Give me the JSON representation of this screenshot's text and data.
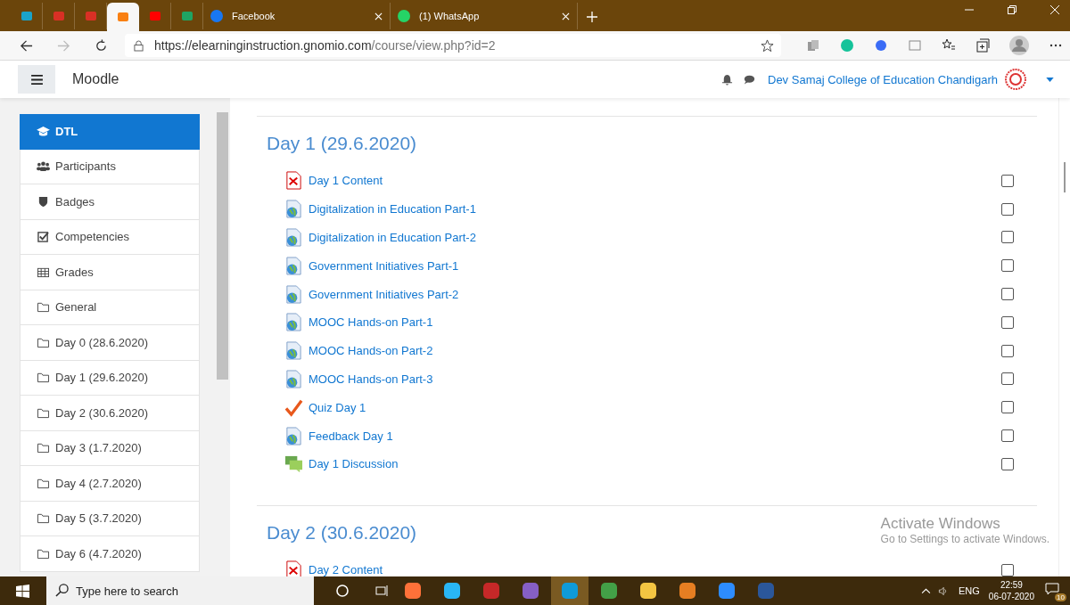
{
  "browser_tabs": [
    {
      "kind": "app",
      "selected": false
    },
    {
      "kind": "mail",
      "selected": false
    },
    {
      "kind": "mail",
      "selected": false
    },
    {
      "kind": "moodle",
      "selected": true
    },
    {
      "kind": "video",
      "selected": false
    },
    {
      "kind": "drive",
      "selected": false
    },
    {
      "kind": "facebook",
      "title": "Facebook",
      "selected": false
    },
    {
      "kind": "whatsapp",
      "title": "(1) WhatsApp",
      "selected": false
    }
  ],
  "address_bar": {
    "host": "https://elearninginstruction.gnomio.com",
    "path": "/course/view.php?id=2"
  },
  "header": {
    "site_name": "Moodle",
    "user_name": "Dev Samaj College of Education Chandigarh"
  },
  "sidebar": {
    "items": [
      {
        "kind": "course",
        "label": "DTL",
        "selected": true
      },
      {
        "kind": "users",
        "label": "Participants",
        "selected": false
      },
      {
        "kind": "shield",
        "label": "Badges",
        "selected": false
      },
      {
        "kind": "check",
        "label": "Competencies",
        "selected": false
      },
      {
        "kind": "table",
        "label": "Grades",
        "selected": false
      },
      {
        "kind": "folder",
        "label": "General",
        "selected": false
      },
      {
        "kind": "folder",
        "label": "Day 0 (28.6.2020)",
        "selected": false
      },
      {
        "kind": "folder",
        "label": "Day 1 (29.6.2020)",
        "selected": false
      },
      {
        "kind": "folder",
        "label": "Day 2 (30.6.2020)",
        "selected": false
      },
      {
        "kind": "folder",
        "label": "Day 3 (1.7.2020)",
        "selected": false
      },
      {
        "kind": "folder",
        "label": "Day 4 (2.7.2020)",
        "selected": false
      },
      {
        "kind": "folder",
        "label": "Day 5 (3.7.2020)",
        "selected": false
      },
      {
        "kind": "folder",
        "label": "Day 6 (4.7.2020)",
        "selected": false
      }
    ]
  },
  "sections": [
    {
      "title": "Day 1 (29.6.2020)",
      "activities": [
        {
          "kind": "pdf",
          "name": "Day 1 Content",
          "checked": false
        },
        {
          "kind": "url",
          "name": "Digitalization in Education Part-1",
          "checked": false
        },
        {
          "kind": "url",
          "name": "Digitalization in Education Part-2",
          "checked": false
        },
        {
          "kind": "url",
          "name": "Government Initiatives Part-1",
          "checked": false
        },
        {
          "kind": "url",
          "name": "Government Initiatives Part-2",
          "checked": false
        },
        {
          "kind": "url",
          "name": "MOOC Hands-on Part-1",
          "checked": false
        },
        {
          "kind": "url",
          "name": "MOOC Hands-on Part-2",
          "checked": false
        },
        {
          "kind": "url",
          "name": "MOOC Hands-on Part-3",
          "checked": false
        },
        {
          "kind": "quiz",
          "name": "Quiz Day 1",
          "checked": false
        },
        {
          "kind": "url",
          "name": "Feedback Day 1",
          "checked": false
        },
        {
          "kind": "forum",
          "name": "Day 1 Discussion",
          "checked": false
        }
      ]
    },
    {
      "title": "Day 2 (30.6.2020)",
      "activities": [
        {
          "kind": "pdf",
          "name": "Day 2 Content",
          "checked": false
        }
      ]
    }
  ],
  "activation_notice": {
    "title": "Activate Windows",
    "text": "Go to Settings to activate Windows."
  },
  "taskbar": {
    "search": {
      "placeholder": "Type here to search"
    },
    "apps": [
      {
        "kind": "firefox",
        "selected": false
      },
      {
        "kind": "share",
        "selected": false
      },
      {
        "kind": "ms",
        "selected": false
      },
      {
        "kind": "studio",
        "selected": false
      },
      {
        "kind": "edge",
        "selected": true
      },
      {
        "kind": "download",
        "selected": false
      },
      {
        "kind": "folder",
        "selected": false
      },
      {
        "kind": "movie",
        "selected": false
      },
      {
        "kind": "zoom",
        "selected": false
      },
      {
        "kind": "word",
        "selected": false
      }
    ],
    "language": "ENG",
    "time": "22:59",
    "date": "06-07-2020",
    "notifications": "10"
  }
}
